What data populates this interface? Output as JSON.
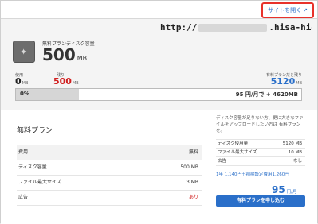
{
  "topbar": {
    "site_link": "サイトを開く",
    "ext_icon": "external-link-icon"
  },
  "url": {
    "prefix": "http://",
    "suffix": ".hisa-hide.com/"
  },
  "capacity": {
    "label": "無料プランディスク容量",
    "value": "500",
    "unit": "MB"
  },
  "stats": {
    "used_label": "使用",
    "used_value": "0",
    "used_unit": "MB",
    "remain_label": "残り",
    "remain_value": "500",
    "remain_unit": "MB",
    "paid_label": "有料プランだと残り",
    "paid_value": "5120",
    "paid_unit": "MB"
  },
  "bar": {
    "percent": "0%",
    "fill_fraction": 0.22,
    "right_text": "95 円/月で + 4620MB"
  },
  "plan": {
    "title": "無料プラン",
    "rows": [
      {
        "k": "費用",
        "v": "無料"
      },
      {
        "k": "ディスク容量",
        "v": "500 MB"
      },
      {
        "k": "ファイル最大サイズ",
        "v": "3 MB"
      },
      {
        "k": "広告",
        "v": "あり"
      }
    ]
  },
  "side": {
    "note": "ディスク容量が足りない方、更に大きなファイルをアップロードしたい方は 有料プランを。",
    "rows": [
      {
        "k": "ディスク使用量",
        "v": "5120 MB"
      },
      {
        "k": "ファイル最大サイズ",
        "v": "10 MB"
      },
      {
        "k": "広告",
        "v": "なし"
      }
    ],
    "price_line": "1年 1,140円＋初期設定費用1,260円",
    "price": "95",
    "price_unit": "円/月",
    "apply_label": "有料プランを申し込む"
  },
  "colors": {
    "accent": "#2a6fc9",
    "alert": "#d12020",
    "site_link_border": "#e8322b"
  }
}
